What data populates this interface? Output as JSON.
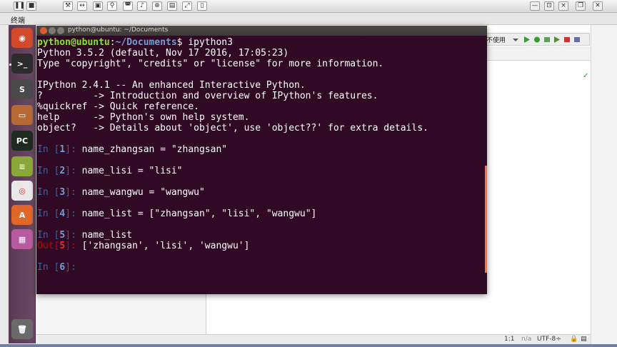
{
  "top_panel": {
    "title": "终端"
  },
  "terminal": {
    "title": "python@ubuntu: ~/Documents",
    "prompt_user": "python@ubuntu",
    "prompt_sep": ":",
    "prompt_path": "~/Documents",
    "prompt_end": "$ ",
    "command": "ipython3",
    "banner": [
      "Python 3.5.2 (default, Nov 17 2016, 17:05:23)",
      "Type \"copyright\", \"credits\" or \"license\" for more information.",
      "",
      "IPython 2.4.1 -- An enhanced Interactive Python.",
      "?         -> Introduction and overview of IPython's features.",
      "%quickref -> Quick reference.",
      "help      -> Python's own help system.",
      "object?   -> Details about 'object', use 'object??' for extra details."
    ],
    "cells": [
      {
        "in_label": "In [",
        "num": "1",
        "in_end": "]: ",
        "code": "name_zhangsan = \"zhangsan\""
      },
      {
        "in_label": "In [",
        "num": "2",
        "in_end": "]: ",
        "code": "name_lisi = \"lisi\""
      },
      {
        "in_label": "In [",
        "num": "3",
        "in_end": "]: ",
        "code": "name_wangwu = \"wangwu\""
      },
      {
        "in_label": "In [",
        "num": "4",
        "in_end": "]: ",
        "code": "name_list = [\"zhangsan\", \"lisi\", \"wangwu\"]"
      },
      {
        "in_label": "In [",
        "num": "5",
        "in_end": "]: ",
        "code": "name_list"
      }
    ],
    "output": {
      "label": "Out[",
      "num": "5",
      "end": "]: ",
      "text": "['zhangsan', 'lisi', 'wangwu']"
    },
    "next_prompt": {
      "label": "In [",
      "num": "6",
      "end": "]: "
    }
  },
  "ide": {
    "run_config_label": "不使用",
    "status_position": "1:1",
    "status_na": "n/a",
    "status_encoding": "UTF-8÷"
  },
  "launcher": {
    "items": [
      {
        "name": "ubuntu-dash-icon",
        "glyph": "◉",
        "color": "#d24a2e"
      },
      {
        "name": "terminal-icon",
        "glyph": ">_",
        "color": "#2c2c2c"
      },
      {
        "name": "sublime-text-icon",
        "glyph": "S",
        "color": "#4a4a4a"
      },
      {
        "name": "files-icon",
        "glyph": "▭",
        "color": "#b56a36"
      },
      {
        "name": "pycharm-icon",
        "glyph": "PC",
        "color": "#1f2b1f"
      },
      {
        "name": "stack-icon",
        "glyph": "≡",
        "color": "#8aa83a"
      },
      {
        "name": "chrome-icon",
        "glyph": "◎",
        "color": "#e8e8e8"
      },
      {
        "name": "software-center-icon",
        "glyph": "A",
        "color": "#e0662a"
      },
      {
        "name": "workspace-icon",
        "glyph": "▦",
        "color": "#b85aa0"
      },
      {
        "name": "trash-icon",
        "glyph": "🗑",
        "color": "#6a6a6a"
      }
    ]
  },
  "colors": {
    "terminal_bg": "#300a24",
    "prompt_green": "#8ae234",
    "prompt_blue": "#729fcf",
    "out_red": "#ef2929"
  }
}
